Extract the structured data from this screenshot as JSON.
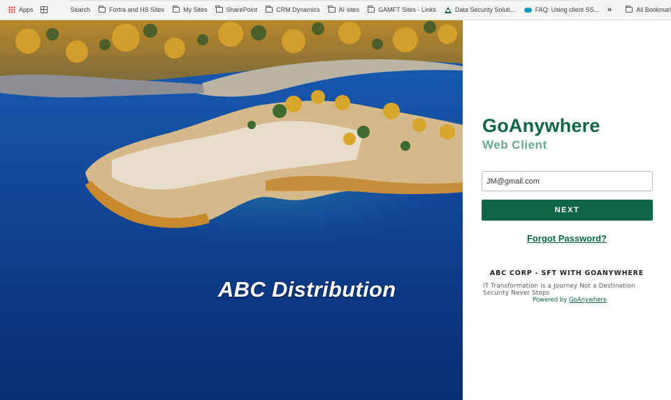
{
  "bookmarks": {
    "apps_label": "Apps",
    "items": [
      {
        "label": "Search",
        "icon": "blank-icon"
      },
      {
        "label": "Fortra and HS Sites",
        "icon": "folder-icon"
      },
      {
        "label": "My Sites",
        "icon": "folder-icon"
      },
      {
        "label": "SharePoint",
        "icon": "folder-icon"
      },
      {
        "label": "CRM Dynamics",
        "icon": "folder-icon"
      },
      {
        "label": "AI sites",
        "icon": "folder-icon"
      },
      {
        "label": "GAMFT Sites - Links",
        "icon": "folder-icon"
      },
      {
        "label": "Data Security Soluti...",
        "icon": "drive-icon"
      },
      {
        "label": "FAQ: Using client SS...",
        "icon": "salesforce-cloud-icon"
      }
    ],
    "overflow_label": "»",
    "all_bookmarks_label": "All Bookmarks"
  },
  "hero": {
    "caption": "ABC Distribution"
  },
  "login": {
    "brand_title": "GoAnywhere",
    "brand_subtitle": "Web Client",
    "email_value": "JM@gmail.com",
    "next_label": "NEXT",
    "forgot_label": "Forgot Password?"
  },
  "footer": {
    "corp_title": "ABC CORP - SFT WITH GOANYWHERE",
    "line1": "IT Transformation is a Journey Not a Destination",
    "line2": "Security Never Stops",
    "powered_prefix": "Powered by ",
    "powered_link": "GoAnywhere"
  },
  "colors": {
    "brand_green": "#0e6645",
    "brand_green_light": "#6aa893",
    "water_blue": "#0d3a8a"
  }
}
